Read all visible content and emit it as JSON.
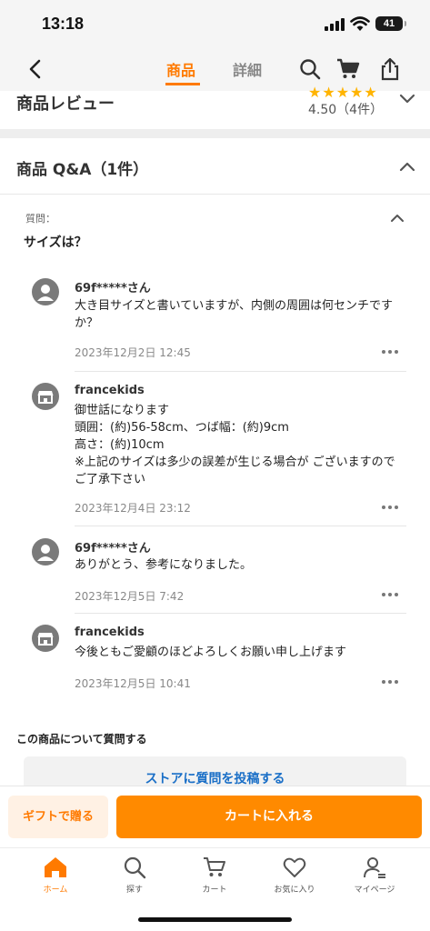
{
  "status_bar": {
    "time": "13:18",
    "battery": "41"
  },
  "header": {
    "tabs": [
      "商品",
      "詳細"
    ]
  },
  "review": {
    "title": "商品レビュー",
    "stars": "★★★★★",
    "rating": "4.50（4件）"
  },
  "qa": {
    "title": "商品 Q&A（1件）",
    "question_label": "質問：",
    "question": "サイズは？",
    "answers": [
      {
        "author": "69f*****さん",
        "text": "大き目サイズと書いていますが、内側の周囲は何センチですか？",
        "date": "2023年12月2日 12:45"
      },
      {
        "author": "francekids",
        "text": "御世話になります\n頭囲：(約)56-58cm、つば幅：(約)9cm\n高さ：(約)10cm\n※上記のサイズは多少の誤差が生じる場合が ございますのでご了承下さい",
        "date": "2023年12月4日 23:12"
      },
      {
        "author": "69f*****さん",
        "text": "ありがとう、参考になりました。",
        "date": "2023年12月5日 7:42"
      },
      {
        "author": "francekids",
        "text": "今後ともご愛顧のほどよろしくお願い申し上げます",
        "date": "2023年12月5日 10:41"
      }
    ]
  },
  "ask": {
    "heading": "この商品について質問する",
    "button": "ストアに質問を投稿する"
  },
  "actions": {
    "gift": "ギフトで贈る",
    "cart": "カートに入れる"
  },
  "tab_bar": {
    "items": [
      "ホーム",
      "探す",
      "カート",
      "お気に入り",
      "マイページ"
    ]
  },
  "colors": {
    "accent": "#ff7a00",
    "link": "#1a6fc7"
  }
}
